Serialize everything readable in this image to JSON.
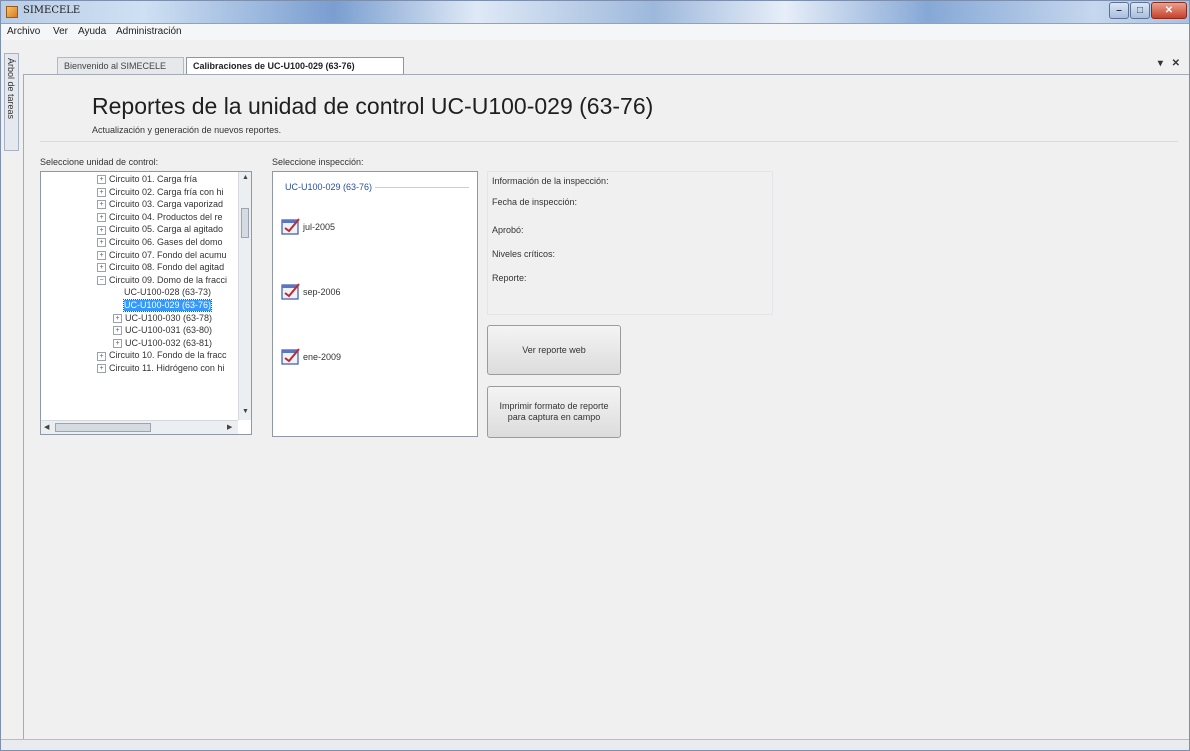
{
  "window": {
    "title": "SIMECELE"
  },
  "menu": [
    "Archivo",
    "Ver",
    "Ayuda",
    "Administración"
  ],
  "side_panel_label": "Árbol de tareas",
  "tabs": [
    {
      "label": "Bienvenido al SIMECELE",
      "active": false
    },
    {
      "label": "Calibraciones de UC-U100-029 (63-76)",
      "active": true
    }
  ],
  "tab_controls": "▾ ✕",
  "header": {
    "title": "Reportes de la unidad de control UC-U100-029 (63-76)",
    "subtitle": "Actualización y generación de nuevos reportes."
  },
  "control_unit": {
    "label": "Seleccione unidad de control:",
    "items": [
      {
        "text": "Circuito 01. Carga fría",
        "level": 0,
        "expander": "+"
      },
      {
        "text": "Circuito 02. Carga fría con hi",
        "level": 0,
        "expander": "+"
      },
      {
        "text": "Circuito 03. Carga vaporizad",
        "level": 0,
        "expander": "+"
      },
      {
        "text": "Circuito 04. Productos del re",
        "level": 0,
        "expander": "+"
      },
      {
        "text": "Circuito 05. Carga al agitado",
        "level": 0,
        "expander": "+"
      },
      {
        "text": "Circuito 06. Gases del domo",
        "level": 0,
        "expander": "+"
      },
      {
        "text": "Circuito 07. Fondo del acumu",
        "level": 0,
        "expander": "+"
      },
      {
        "text": "Circuito 08. Fondo del agitad",
        "level": 0,
        "expander": "+"
      },
      {
        "text": "Circuito 09. Domo de la fracci",
        "level": 0,
        "expander": "−"
      },
      {
        "text": "UC-U100-028 (63-73)",
        "level": 1,
        "expander": ""
      },
      {
        "text": "UC-U100-029 (63-76)",
        "level": 1,
        "expander": "",
        "selected": true
      },
      {
        "text": "UC-U100-030 (63-78)",
        "level": 1,
        "expander": "+"
      },
      {
        "text": "UC-U100-031 (63-80)",
        "level": 1,
        "expander": "+"
      },
      {
        "text": "UC-U100-032 (63-81)",
        "level": 1,
        "expander": "+"
      },
      {
        "text": "Circuito 10. Fondo de la fracc",
        "level": 0,
        "expander": "+"
      },
      {
        "text": "Circuito 11. Hidrógeno con hi",
        "level": 0,
        "expander": "+"
      }
    ]
  },
  "inspection": {
    "label": "Seleccione inspección:",
    "group": "UC-U100-029 (63-76)",
    "items": [
      "jul-2005",
      "sep-2006",
      "ene-2009"
    ]
  },
  "info": {
    "title": "Información de la inspección:",
    "fields": [
      "Fecha de inspección:",
      "Aprobó:",
      "Niveles críticos:",
      "Reporte:"
    ]
  },
  "buttons": {
    "view_web": "Ver reporte web",
    "print_format_line1": "Imprimir formato de reporte",
    "print_format_line2": "para captura en campo"
  },
  "colors": {
    "selection": "#3399ff",
    "group_text": "#2b4da0"
  }
}
